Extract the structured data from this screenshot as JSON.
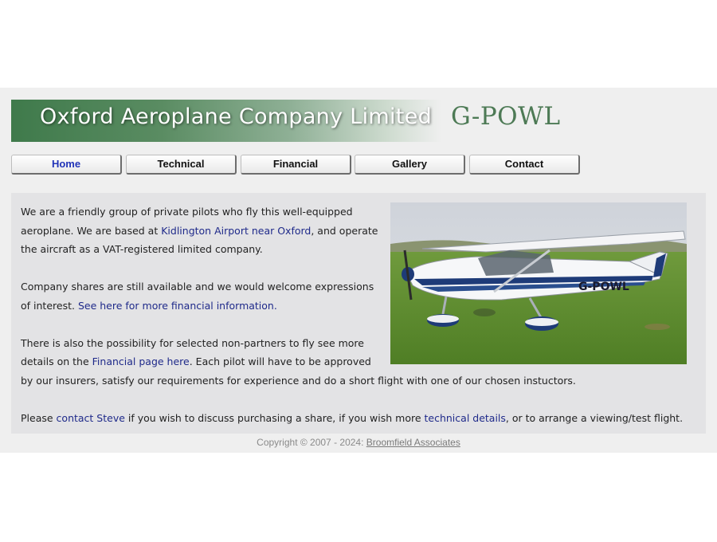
{
  "header": {
    "title": "Oxford Aeroplane Company Limited",
    "registration": "G-POWL"
  },
  "nav": {
    "items": [
      {
        "label": "Home",
        "active": true
      },
      {
        "label": "Technical",
        "active": false
      },
      {
        "label": "Financial",
        "active": false
      },
      {
        "label": "Gallery",
        "active": false
      },
      {
        "label": "Contact",
        "active": false
      }
    ]
  },
  "content": {
    "p1": {
      "t1": "We are a friendly group of private pilots who fly this well-equipped aeroplane. We are based at ",
      "link": "Kidlington Airport near Oxford",
      "t2": ", and operate the aircraft as a VAT-registered limited company."
    },
    "p2": {
      "t1": "Company shares are still available and we would welcome expressions of interest. ",
      "link": "See here for more financial information."
    },
    "p3": {
      "t1": "There is also the possibility for selected non-partners to fly see more details on the ",
      "link": "Financial page here",
      "t2": ". Each pilot will have to be approved by our insurers, satisfy our requirements for experience and do a short flight with one of our chosen instuctors."
    },
    "p4": {
      "t1": "Please ",
      "link1": "contact Steve",
      "t2": " if you wish to discuss purchasing a share, if you wish more ",
      "link2": "technical details",
      "t3": ", or to arrange a viewing/test flight."
    },
    "photo": {
      "registration": "G-POWL"
    }
  },
  "footer": {
    "copyright": "Copyright © 2007 - 2024: ",
    "link": "Broomfield Associates"
  },
  "colors": {
    "band": "#efefef",
    "content_bg": "#e3e3e5",
    "link": "#1f2a8a",
    "accent_green": "#4d7a55"
  }
}
